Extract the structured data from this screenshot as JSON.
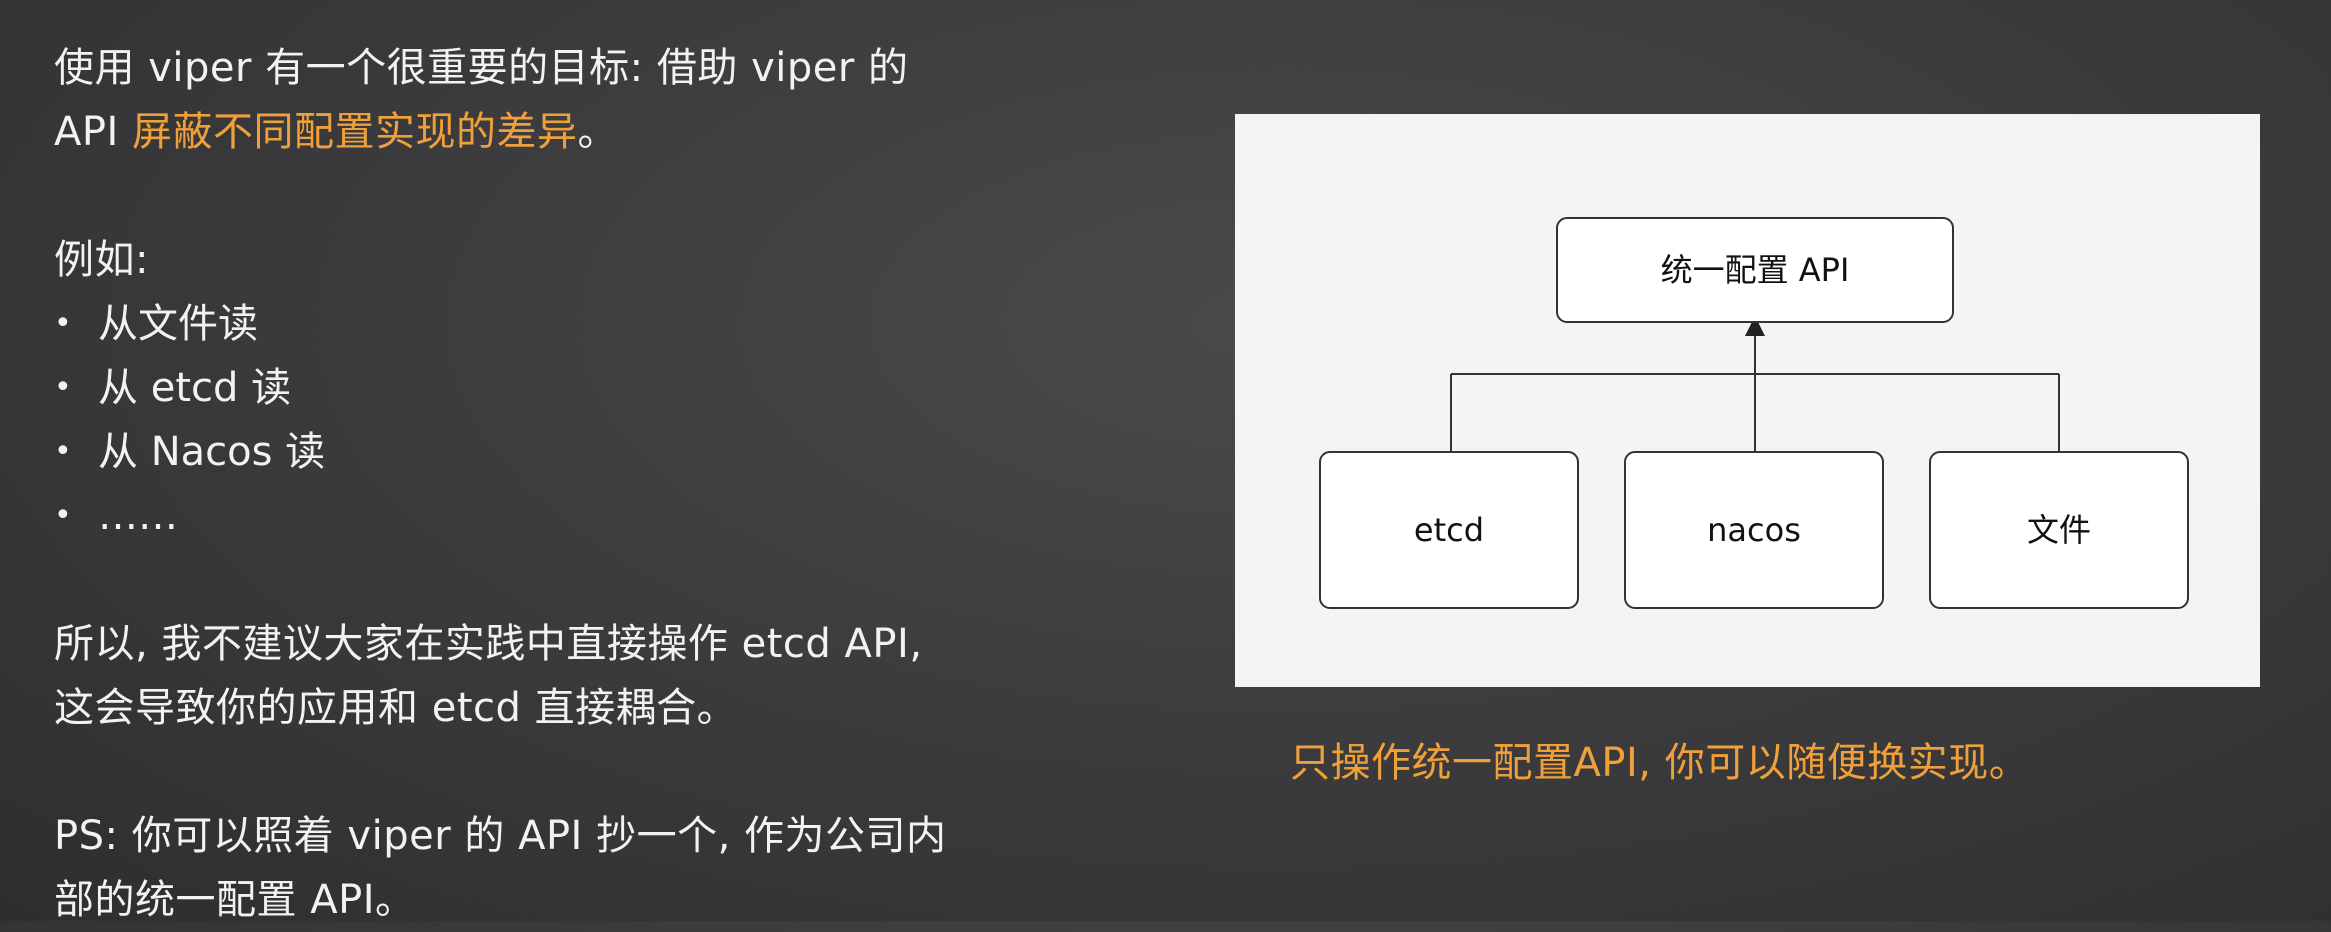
{
  "left": {
    "line1": "使用 viper 有一个很重要的目标: 借助 viper 的",
    "line2_prefix": "API ",
    "line2_highlight": "屏蔽不同配置实现的差异",
    "line2_suffix": "。",
    "example_heading": "例如:",
    "bullets": [
      "从文件读",
      "从 etcd 读",
      "从 Nacos 读",
      "……"
    ],
    "para2_line1": "所以, 我不建议大家在实践中直接操作 etcd API,",
    "para2_line2": "这会导致你的应用和 etcd 直接耦合。",
    "ps_line1": "PS: 你可以照着 viper 的 API 抄一个, 作为公司内",
    "ps_line2": "部的统一配置 API。"
  },
  "diagram": {
    "top_box": "统一配置  API",
    "boxes": [
      "etcd",
      "nacos",
      "文件"
    ]
  },
  "caption": "只操作统一配置API, 你可以随便换实现。",
  "colors": {
    "highlight": "#f0a03a",
    "text": "#f2f2f2",
    "diagram_bg": "#f4f4f5"
  }
}
